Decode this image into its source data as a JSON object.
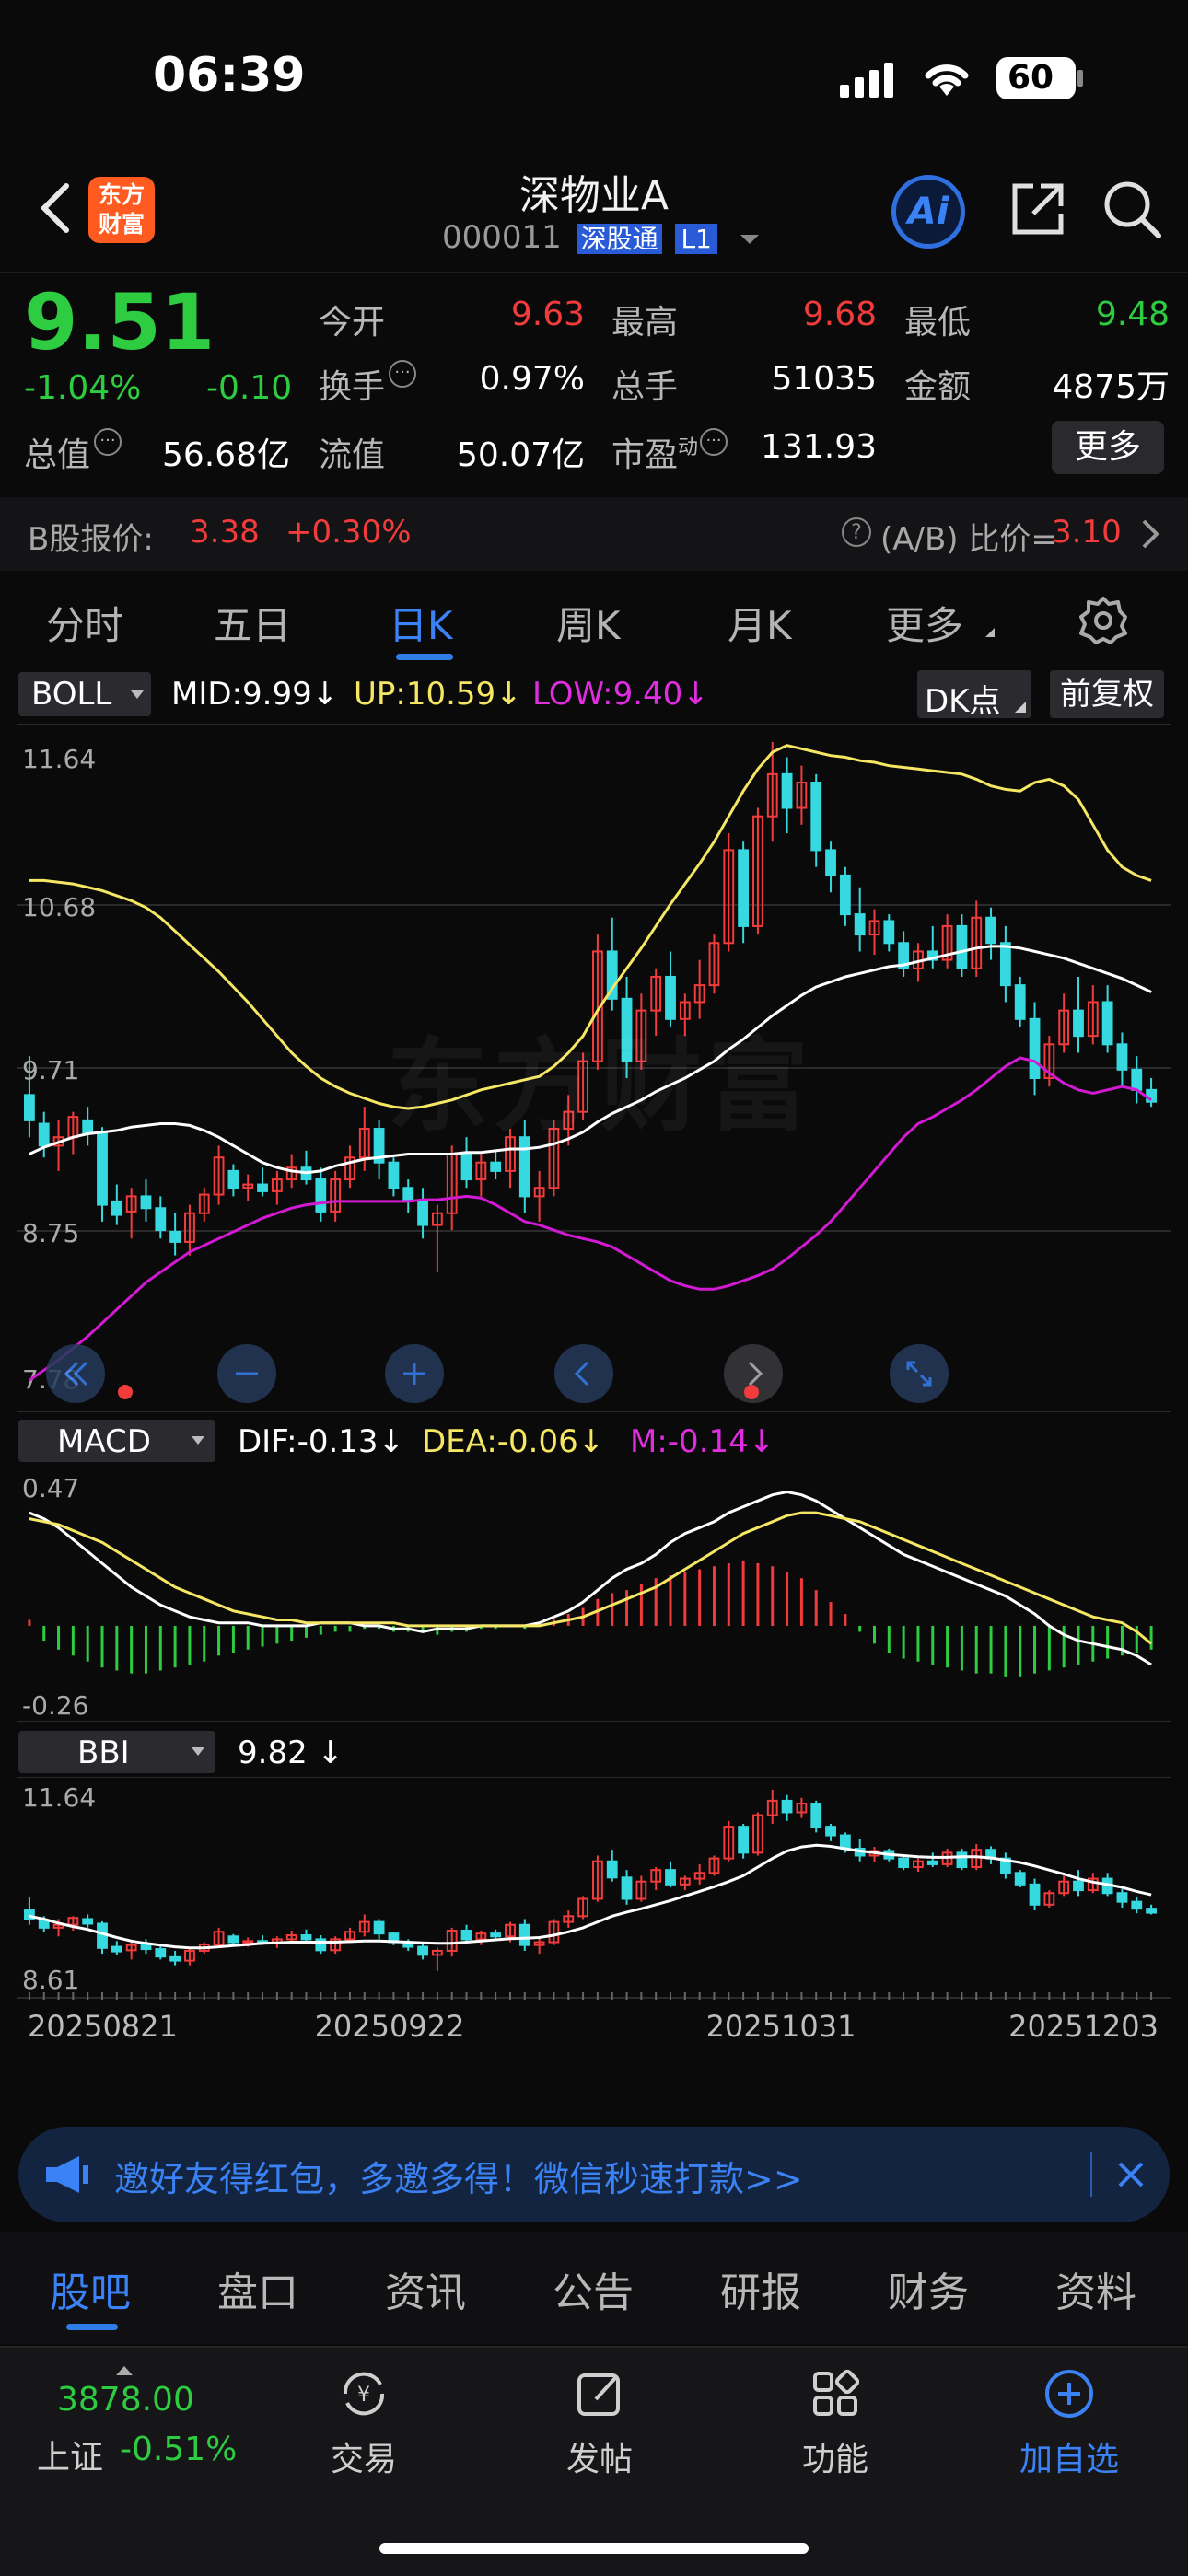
{
  "status_bar": {
    "time": "06:39",
    "battery": "60"
  },
  "header": {
    "logo": "东方\n财富",
    "stock_name": "深物业A",
    "stock_code": "000011",
    "badge_hk": "深股通",
    "badge_level": "L1",
    "ai_label": "Ai"
  },
  "quote": {
    "price": "9.51",
    "change_pct": "-1.04%",
    "change": "-0.10",
    "open_label": "今开",
    "open": "9.63",
    "high_label": "最高",
    "high": "9.68",
    "low_label": "最低",
    "low": "9.48",
    "turnover_label": "换手",
    "turnover": "0.97%",
    "volume_label": "总手",
    "volume": "51035",
    "amount_label": "金额",
    "amount": "4875万",
    "mktcap_label": "总值",
    "mktcap": "56.68亿",
    "float_label": "流值",
    "float": "50.07亿",
    "pe_label": "市盈",
    "pe_sup": "动",
    "pe": "131.93",
    "more": "更多"
  },
  "bshare": {
    "label": "B股报价:",
    "price": "3.38",
    "pct": "+0.30%",
    "ratio_label": "(A/B) 比价=",
    "ratio": "3.10"
  },
  "period_tabs": [
    "分时",
    "五日",
    "日K",
    "周K",
    "月K",
    "更多"
  ],
  "active_period": "日K",
  "chart_controls": {
    "dk": "DK点",
    "adj": "前复权"
  },
  "boll": {
    "name": "BOLL",
    "mid": "MID:9.99",
    "up": "UP:10.59",
    "low": "LOW:9.40"
  },
  "macd": {
    "name": "MACD",
    "dif": "DIF:-0.13",
    "dea": "DEA:-0.06",
    "m": "M:-0.14"
  },
  "bbi": {
    "name": "BBI",
    "value": "9.82"
  },
  "colors": {
    "up": "#f23b3b",
    "down": "#2ecc40",
    "candle_down": "#36d9e0",
    "boll_up": "#f5e663",
    "boll_low": "#d21ad2",
    "accent": "#2f7de6"
  },
  "chart_data": [
    {
      "type": "candlestick",
      "title": "BOLL",
      "ylim": [
        7.78,
        11.64
      ],
      "y_ticks": [
        "11.64",
        "10.68",
        "9.71",
        "8.75",
        "7.78"
      ],
      "watermark": "东方财富",
      "x_labels": [
        "20250821",
        "20250922",
        "20251031",
        "20251203"
      ],
      "ohlc": [
        [
          9.55,
          9.78,
          9.3,
          9.4
        ],
        [
          9.38,
          9.45,
          9.18,
          9.25
        ],
        [
          9.25,
          9.4,
          9.1,
          9.3
        ],
        [
          9.3,
          9.45,
          9.2,
          9.42
        ],
        [
          9.4,
          9.48,
          9.25,
          9.32
        ],
        [
          9.32,
          9.36,
          8.8,
          8.9
        ],
        [
          8.92,
          9.02,
          8.78,
          8.84
        ],
        [
          8.86,
          9.0,
          8.7,
          8.95
        ],
        [
          8.95,
          9.05,
          8.8,
          8.88
        ],
        [
          8.88,
          8.95,
          8.7,
          8.75
        ],
        [
          8.74,
          8.85,
          8.6,
          8.68
        ],
        [
          8.68,
          8.9,
          8.6,
          8.85
        ],
        [
          8.85,
          9.0,
          8.8,
          8.96
        ],
        [
          8.96,
          9.25,
          8.9,
          9.18
        ],
        [
          9.1,
          9.14,
          8.95,
          9.0
        ],
        [
          9.0,
          9.08,
          8.92,
          9.02
        ],
        [
          9.02,
          9.12,
          8.95,
          8.98
        ],
        [
          8.98,
          9.1,
          8.9,
          9.05
        ],
        [
          9.05,
          9.2,
          9.0,
          9.12
        ],
        [
          9.12,
          9.22,
          9.02,
          9.05
        ],
        [
          9.05,
          9.12,
          8.8,
          8.86
        ],
        [
          8.86,
          9.1,
          8.8,
          9.05
        ],
        [
          9.05,
          9.25,
          9.0,
          9.18
        ],
        [
          9.18,
          9.48,
          9.1,
          9.35
        ],
        [
          9.35,
          9.4,
          9.05,
          9.15
        ],
        [
          9.15,
          9.18,
          8.95,
          9.0
        ],
        [
          9.0,
          9.05,
          8.85,
          8.92
        ],
        [
          8.92,
          9.0,
          8.7,
          8.78
        ],
        [
          8.78,
          8.9,
          8.5,
          8.85
        ],
        [
          8.85,
          9.25,
          8.75,
          9.2
        ],
        [
          9.2,
          9.3,
          9.0,
          9.05
        ],
        [
          9.05,
          9.2,
          8.95,
          9.15
        ],
        [
          9.15,
          9.22,
          9.05,
          9.1
        ],
        [
          9.1,
          9.35,
          9.0,
          9.3
        ],
        [
          9.3,
          9.4,
          8.85,
          8.95
        ],
        [
          8.95,
          9.1,
          8.8,
          9.0
        ],
        [
          9.0,
          9.4,
          8.95,
          9.35
        ],
        [
          9.35,
          9.55,
          9.25,
          9.45
        ],
        [
          9.45,
          9.8,
          9.4,
          9.75
        ],
        [
          9.75,
          10.5,
          9.7,
          10.4
        ],
        [
          10.4,
          10.6,
          10.05,
          10.12
        ],
        [
          10.12,
          10.25,
          9.65,
          9.75
        ],
        [
          9.75,
          10.15,
          9.7,
          10.05
        ],
        [
          10.05,
          10.3,
          9.9,
          10.25
        ],
        [
          10.25,
          10.4,
          9.95,
          10.0
        ],
        [
          10.0,
          10.15,
          9.9,
          10.1
        ],
        [
          10.1,
          10.35,
          10.0,
          10.2
        ],
        [
          10.2,
          10.5,
          10.15,
          10.45
        ],
        [
          10.45,
          11.1,
          10.4,
          11.0
        ],
        [
          11.0,
          11.05,
          10.45,
          10.55
        ],
        [
          10.55,
          11.25,
          10.5,
          11.2
        ],
        [
          11.2,
          11.64,
          11.05,
          11.45
        ],
        [
          11.45,
          11.55,
          11.1,
          11.25
        ],
        [
          11.25,
          11.5,
          11.15,
          11.4
        ],
        [
          11.4,
          11.45,
          10.9,
          11.0
        ],
        [
          11.0,
          11.05,
          10.75,
          10.85
        ],
        [
          10.85,
          10.9,
          10.55,
          10.62
        ],
        [
          10.62,
          10.78,
          10.4,
          10.5
        ],
        [
          10.5,
          10.65,
          10.38,
          10.58
        ],
        [
          10.58,
          10.62,
          10.4,
          10.45
        ],
        [
          10.45,
          10.52,
          10.25,
          10.3
        ],
        [
          10.3,
          10.45,
          10.22,
          10.4
        ],
        [
          10.4,
          10.55,
          10.3,
          10.35
        ],
        [
          10.35,
          10.62,
          10.3,
          10.55
        ],
        [
          10.55,
          10.62,
          10.25,
          10.3
        ],
        [
          10.3,
          10.7,
          10.25,
          10.6
        ],
        [
          10.6,
          10.66,
          10.35,
          10.45
        ],
        [
          10.45,
          10.55,
          10.1,
          10.2
        ],
        [
          10.2,
          10.25,
          9.95,
          10.0
        ],
        [
          10.0,
          10.1,
          9.55,
          9.65
        ],
        [
          9.65,
          9.9,
          9.6,
          9.85
        ],
        [
          9.85,
          10.15,
          9.8,
          10.05
        ],
        [
          10.05,
          10.25,
          9.8,
          9.9
        ],
        [
          9.9,
          10.2,
          9.85,
          10.1
        ],
        [
          10.1,
          10.2,
          9.8,
          9.85
        ],
        [
          9.85,
          9.92,
          9.6,
          9.7
        ],
        [
          9.7,
          9.78,
          9.5,
          9.58
        ],
        [
          9.58,
          9.65,
          9.48,
          9.51
        ]
      ],
      "series": [
        {
          "name": "MID",
          "values": [
            9.2,
            9.24,
            9.27,
            9.3,
            9.32,
            9.33,
            9.34,
            9.36,
            9.37,
            9.38,
            9.38,
            9.37,
            9.34,
            9.3,
            9.25,
            9.2,
            9.15,
            9.12,
            9.1,
            9.09,
            9.1,
            9.13,
            9.15,
            9.17,
            9.18,
            9.19,
            9.2,
            9.2,
            9.2,
            9.2,
            9.21,
            9.21,
            9.22,
            9.23,
            9.23,
            9.24,
            9.26,
            9.29,
            9.33,
            9.39,
            9.44,
            9.48,
            9.52,
            9.57,
            9.61,
            9.65,
            9.7,
            9.75,
            9.82,
            9.88,
            9.95,
            10.02,
            10.08,
            10.14,
            10.19,
            10.22,
            10.25,
            10.27,
            10.29,
            10.31,
            10.32,
            10.34,
            10.36,
            10.38,
            10.4,
            10.42,
            10.43,
            10.43,
            10.42,
            10.4,
            10.38,
            10.36,
            10.33,
            10.3,
            10.27,
            10.24,
            10.2,
            10.16
          ]
        },
        {
          "name": "UP",
          "values": [
            10.82,
            10.82,
            10.81,
            10.8,
            10.78,
            10.76,
            10.73,
            10.7,
            10.66,
            10.6,
            10.52,
            10.44,
            10.36,
            10.28,
            10.19,
            10.1,
            10.0,
            9.9,
            9.8,
            9.72,
            9.65,
            9.6,
            9.56,
            9.53,
            9.5,
            9.48,
            9.47,
            9.48,
            9.5,
            9.52,
            9.55,
            9.58,
            9.6,
            9.62,
            9.64,
            9.66,
            9.72,
            9.8,
            9.9,
            10.05,
            10.18,
            10.3,
            10.42,
            10.55,
            10.68,
            10.8,
            10.92,
            11.05,
            11.2,
            11.35,
            11.48,
            11.58,
            11.62,
            11.6,
            11.58,
            11.56,
            11.55,
            11.53,
            11.52,
            11.5,
            11.49,
            11.48,
            11.47,
            11.46,
            11.45,
            11.42,
            11.38,
            11.36,
            11.35,
            11.4,
            11.42,
            11.38,
            11.3,
            11.15,
            11.0,
            10.9,
            10.85,
            10.82
          ]
        },
        {
          "name": "LOW",
          "values": [
            7.86,
            7.92,
            7.98,
            8.05,
            8.12,
            8.2,
            8.28,
            8.36,
            8.44,
            8.5,
            8.56,
            8.62,
            8.66,
            8.7,
            8.74,
            8.78,
            8.82,
            8.85,
            8.88,
            8.9,
            8.91,
            8.92,
            8.92,
            8.92,
            8.92,
            8.92,
            8.92,
            8.93,
            8.93,
            8.94,
            8.95,
            8.94,
            8.9,
            8.85,
            8.8,
            8.78,
            8.75,
            8.72,
            8.7,
            8.68,
            8.65,
            8.6,
            8.55,
            8.5,
            8.45,
            8.42,
            8.4,
            8.4,
            8.42,
            8.45,
            8.48,
            8.52,
            8.58,
            8.65,
            8.72,
            8.8,
            8.9,
            9.0,
            9.1,
            9.2,
            9.3,
            9.38,
            9.42,
            9.47,
            9.52,
            9.58,
            9.65,
            9.72,
            9.77,
            9.75,
            9.68,
            9.62,
            9.58,
            9.56,
            9.58,
            9.6,
            9.58,
            9.52
          ]
        }
      ]
    },
    {
      "type": "bar",
      "title": "MACD",
      "ylim": [
        -0.26,
        0.47
      ],
      "y_ticks": [
        "0.47",
        "-0.26"
      ],
      "histogram": [
        0.02,
        -0.05,
        -0.08,
        -0.1,
        -0.12,
        -0.14,
        -0.15,
        -0.16,
        -0.16,
        -0.15,
        -0.14,
        -0.13,
        -0.12,
        -0.1,
        -0.09,
        -0.08,
        -0.07,
        -0.06,
        -0.05,
        -0.04,
        -0.03,
        -0.02,
        -0.02,
        -0.01,
        -0.01,
        -0.02,
        -0.02,
        -0.02,
        -0.03,
        -0.02,
        -0.02,
        -0.01,
        -0.01,
        0.0,
        -0.01,
        0.01,
        0.02,
        0.04,
        0.06,
        0.09,
        0.11,
        0.12,
        0.14,
        0.16,
        0.17,
        0.18,
        0.19,
        0.2,
        0.21,
        0.22,
        0.21,
        0.2,
        0.18,
        0.16,
        0.12,
        0.08,
        0.04,
        -0.02,
        -0.06,
        -0.09,
        -0.11,
        -0.12,
        -0.13,
        -0.14,
        -0.15,
        -0.16,
        -0.16,
        -0.17,
        -0.17,
        -0.16,
        -0.15,
        -0.14,
        -0.13,
        -0.12,
        -0.11,
        -0.1,
        -0.09,
        -0.08
      ],
      "series": [
        {
          "name": "DIF",
          "values": [
            0.38,
            0.36,
            0.33,
            0.29,
            0.25,
            0.21,
            0.17,
            0.13,
            0.1,
            0.07,
            0.05,
            0.03,
            0.02,
            0.01,
            0.01,
            0.01,
            0.0,
            0.0,
            0.0,
            0.0,
            0.01,
            0.01,
            0.01,
            0.0,
            0.0,
            -0.01,
            -0.01,
            -0.02,
            -0.01,
            -0.01,
            -0.01,
            0.0,
            0.0,
            0.0,
            0.0,
            0.01,
            0.03,
            0.05,
            0.08,
            0.12,
            0.16,
            0.19,
            0.21,
            0.24,
            0.28,
            0.31,
            0.33,
            0.35,
            0.38,
            0.4,
            0.42,
            0.44,
            0.45,
            0.44,
            0.42,
            0.39,
            0.36,
            0.33,
            0.3,
            0.27,
            0.24,
            0.22,
            0.2,
            0.18,
            0.16,
            0.14,
            0.12,
            0.1,
            0.07,
            0.04,
            0.0,
            -0.03,
            -0.05,
            -0.06,
            -0.07,
            -0.08,
            -0.1,
            -0.13
          ]
        },
        {
          "name": "DEA",
          "values": [
            0.36,
            0.35,
            0.34,
            0.32,
            0.3,
            0.28,
            0.25,
            0.22,
            0.19,
            0.16,
            0.13,
            0.11,
            0.09,
            0.07,
            0.05,
            0.04,
            0.03,
            0.02,
            0.02,
            0.01,
            0.01,
            0.01,
            0.01,
            0.01,
            0.01,
            0.01,
            0.0,
            0.0,
            0.0,
            0.0,
            0.0,
            0.0,
            0.0,
            0.0,
            0.0,
            0.0,
            0.01,
            0.02,
            0.03,
            0.05,
            0.07,
            0.09,
            0.11,
            0.13,
            0.16,
            0.19,
            0.22,
            0.25,
            0.28,
            0.31,
            0.33,
            0.35,
            0.37,
            0.38,
            0.38,
            0.37,
            0.36,
            0.35,
            0.33,
            0.31,
            0.29,
            0.27,
            0.25,
            0.23,
            0.21,
            0.19,
            0.17,
            0.15,
            0.13,
            0.11,
            0.09,
            0.07,
            0.05,
            0.03,
            0.02,
            0.01,
            -0.02,
            -0.06
          ]
        }
      ]
    },
    {
      "type": "candlestick",
      "title": "BBI",
      "ylim": [
        8.61,
        11.64
      ],
      "y_ticks": [
        "11.64",
        "8.61"
      ],
      "x_labels": [
        "20250821",
        "20250922",
        "20251031",
        "20251203"
      ],
      "series": [
        {
          "name": "BBI",
          "values": [
            9.45,
            9.4,
            9.33,
            9.27,
            9.22,
            9.15,
            9.08,
            9.02,
            8.98,
            8.95,
            8.92,
            8.9,
            8.9,
            8.92,
            8.94,
            8.96,
            8.98,
            8.99,
            9.0,
            9.0,
            9.0,
            9.0,
            9.01,
            9.02,
            9.02,
            9.01,
            9.0,
            8.99,
            8.98,
            8.98,
            9.0,
            9.02,
            9.04,
            9.06,
            9.07,
            9.08,
            9.12,
            9.18,
            9.25,
            9.35,
            9.45,
            9.52,
            9.58,
            9.65,
            9.72,
            9.8,
            9.88,
            9.96,
            10.05,
            10.15,
            10.3,
            10.45,
            10.58,
            10.65,
            10.68,
            10.66,
            10.62,
            10.58,
            10.55,
            10.52,
            10.5,
            10.48,
            10.47,
            10.47,
            10.48,
            10.48,
            10.46,
            10.42,
            10.38,
            10.32,
            10.25,
            10.18,
            10.1,
            10.04,
            10.0,
            9.95,
            9.88,
            9.82
          ]
        }
      ]
    }
  ],
  "promo": {
    "text": "邀好友得红包，多邀多得！微信秒速打款>>"
  },
  "bottom_tabs": [
    "股吧",
    "盘口",
    "资讯",
    "公告",
    "研报",
    "财务",
    "资料"
  ],
  "active_bottom_tab": "股吧",
  "footer": {
    "index_value": "3878.00",
    "index_name": "上证",
    "index_pct": "-0.51%",
    "trade": "交易",
    "post": "发帖",
    "func": "功能",
    "add": "加自选"
  }
}
